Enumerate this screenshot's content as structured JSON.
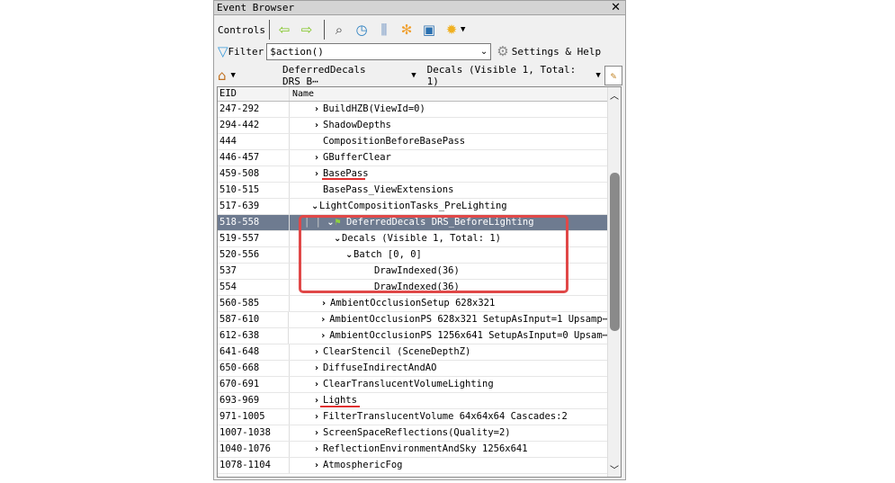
{
  "window": {
    "title": "Event Browser"
  },
  "controls": {
    "label": "Controls"
  },
  "filter": {
    "label": "Filter",
    "value": "$action()",
    "settings_label": "Settings & Help"
  },
  "nav": {
    "breadcrumb1": "DeferredDecals DRS_B⋯",
    "breadcrumb2": "Decals (Visible 1, Total: 1)"
  },
  "table": {
    "columns": [
      "EID",
      "Name"
    ],
    "rows": [
      {
        "eid": "247-292",
        "name": "BuildHZB(ViewId=0)",
        "level": 0,
        "arrow": ">"
      },
      {
        "eid": "294-442",
        "name": "ShadowDepths",
        "level": 0,
        "arrow": ">"
      },
      {
        "eid": "444",
        "name": "CompositionBeforeBasePass",
        "level": 0,
        "arrow": ""
      },
      {
        "eid": "446-457",
        "name": "GBufferClear",
        "level": 0,
        "arrow": ">"
      },
      {
        "eid": "459-508",
        "name": "BasePass",
        "level": 0,
        "arrow": ">"
      },
      {
        "eid": "510-515",
        "name": "BasePass_ViewExtensions",
        "level": 0,
        "arrow": ""
      },
      {
        "eid": "517-639",
        "name": "LightCompositionTasks_PreLighting",
        "level": -0.5,
        "arrow": "v"
      },
      {
        "eid": "518-558",
        "name": "DeferredDecals DRS_BeforeLighting",
        "level": 1,
        "arrow": "v",
        "selected": true
      },
      {
        "eid": "519-557",
        "name": "Decals (Visible 1, Total: 1)",
        "level": 2,
        "arrow": "v"
      },
      {
        "eid": "520-556",
        "name": "Batch [0, 0]",
        "level": 3,
        "arrow": "v"
      },
      {
        "eid": "537",
        "name": "DrawIndexed(36)",
        "level": 4,
        "arrow": ""
      },
      {
        "eid": "554",
        "name": "DrawIndexed(36)",
        "level": 4,
        "arrow": ""
      },
      {
        "eid": "560-585",
        "name": "AmbientOcclusionSetup 628x321",
        "level": 1,
        "arrow": ">"
      },
      {
        "eid": "587-610",
        "name": "AmbientOcclusionPS 628x321 SetupAsInput=1 Upsamp⋯",
        "level": 1,
        "arrow": ">"
      },
      {
        "eid": "612-638",
        "name": "AmbientOcclusionPS 1256x641 SetupAsInput=0 Upsam⋯",
        "level": 1,
        "arrow": ">"
      },
      {
        "eid": "641-648",
        "name": "ClearStencil (SceneDepthZ)",
        "level": 0,
        "arrow": ">"
      },
      {
        "eid": "650-668",
        "name": "DiffuseIndirectAndAO",
        "level": 0,
        "arrow": ">"
      },
      {
        "eid": "670-691",
        "name": "ClearTranslucentVolumeLighting",
        "level": 0,
        "arrow": ">"
      },
      {
        "eid": "693-969",
        "name": "Lights",
        "level": 0,
        "arrow": ">"
      },
      {
        "eid": "971-1005",
        "name": "FilterTranslucentVolume 64x64x64 Cascades:2",
        "level": 0,
        "arrow": ">"
      },
      {
        "eid": "1007-1038",
        "name": "ScreenSpaceReflections(Quality=2)",
        "level": 0,
        "arrow": ">"
      },
      {
        "eid": "1040-1076",
        "name": "ReflectionEnvironmentAndSky 1256x641",
        "level": 0,
        "arrow": ">"
      },
      {
        "eid": "1078-1104",
        "name": "AtmosphericFog",
        "level": 0,
        "arrow": ">"
      }
    ]
  },
  "colors": {
    "selected": "#6e7b90",
    "annotation": "#e04848"
  }
}
